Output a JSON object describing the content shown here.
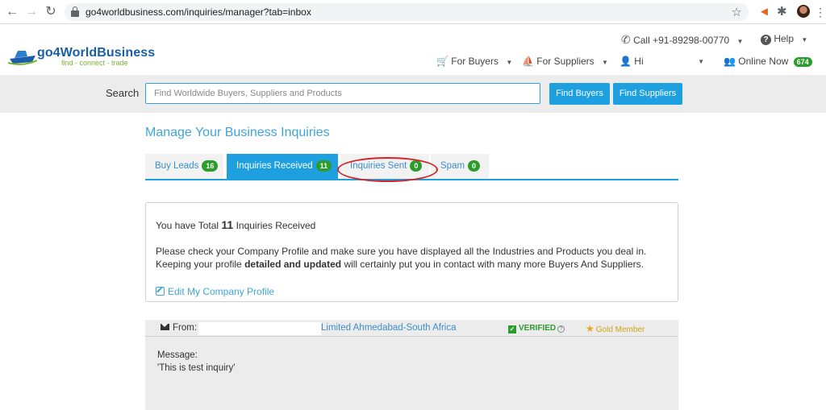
{
  "browser": {
    "url": "go4worldbusiness.com/inquiries/manager?tab=inbox"
  },
  "header": {
    "logo_name": "go4WorldBusiness",
    "logo_tagline": "find - connect - trade",
    "call": "Call +91-89298-00770",
    "help": "Help",
    "for_buyers": "For Buyers",
    "for_suppliers": "For Suppliers",
    "user": "Hi",
    "online_label": "Online Now",
    "online_count": "674"
  },
  "search": {
    "label": "Search",
    "placeholder": "Find Worldwide Buyers, Suppliers and Products",
    "find_buyers": "Find Buyers",
    "find_suppliers": "Find Suppliers"
  },
  "main": {
    "title": "Manage Your Business Inquiries",
    "tabs": [
      {
        "label": "Buy Leads",
        "count": "16"
      },
      {
        "label": "Inquiries Received",
        "count": "11"
      },
      {
        "label": "Inquiries Sent",
        "count": "0"
      },
      {
        "label": "Spam",
        "count": "0"
      }
    ],
    "info": {
      "total_prefix": "You have Total",
      "total_count": "11",
      "total_suffix": "Inquiries Received",
      "para_1": "Please check your Company Profile and make sure you have displayed all the Industries and Products you deal in. Keeping your profile",
      "para_bold": "detailed and updated",
      "para_2": "will certainly put you in contact with many more Buyers And Suppliers.",
      "edit_link": "Edit My Company Profile"
    },
    "message": {
      "from_label": "From:",
      "company": "Limited Ahmedabad-South Africa",
      "verified": "VERIFIED",
      "member": "Gold Member",
      "msg_label": "Message:",
      "msg_body": "'This is test inquiry'"
    }
  },
  "colors": {
    "accent": "#1ea0e0",
    "badge_green": "#2c9c2c",
    "annotation_red": "#d4242a"
  }
}
